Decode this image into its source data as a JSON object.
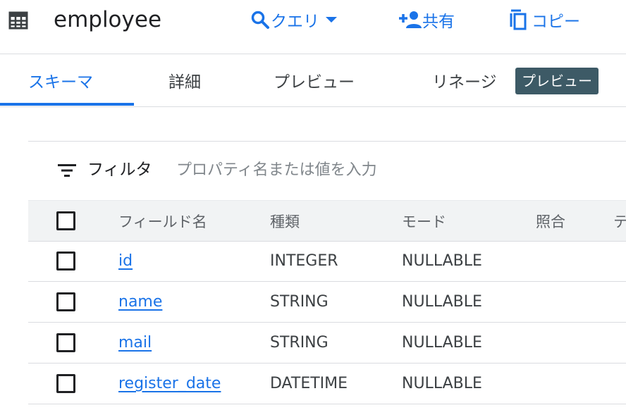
{
  "header": {
    "title": "employee",
    "query_label": "クエリ",
    "share_label": "共有",
    "copy_label": "コピー"
  },
  "tabs": [
    {
      "label": "スキーマ",
      "active": true
    },
    {
      "label": "詳細"
    },
    {
      "label": "プレビュー"
    },
    {
      "label": "リネージ"
    }
  ],
  "lineage_badge": "プレビュー",
  "filter": {
    "label": "フィルタ",
    "placeholder": "プロパティ名または値を入力"
  },
  "table": {
    "columns": [
      "フィールド名",
      "種類",
      "モード",
      "照合",
      "テ"
    ],
    "rows": [
      {
        "field": "id",
        "type": "INTEGER",
        "mode": "NULLABLE"
      },
      {
        "field": "name",
        "type": "STRING",
        "mode": "NULLABLE"
      },
      {
        "field": "mail",
        "type": "STRING",
        "mode": "NULLABLE"
      },
      {
        "field": "register_date",
        "type": "DATETIME",
        "mode": "NULLABLE"
      }
    ]
  },
  "colors": {
    "accent": "#1a73e8",
    "badge_bg": "#3d5a66",
    "header_bg": "#f1f3f4",
    "divider": "#dadce0"
  }
}
